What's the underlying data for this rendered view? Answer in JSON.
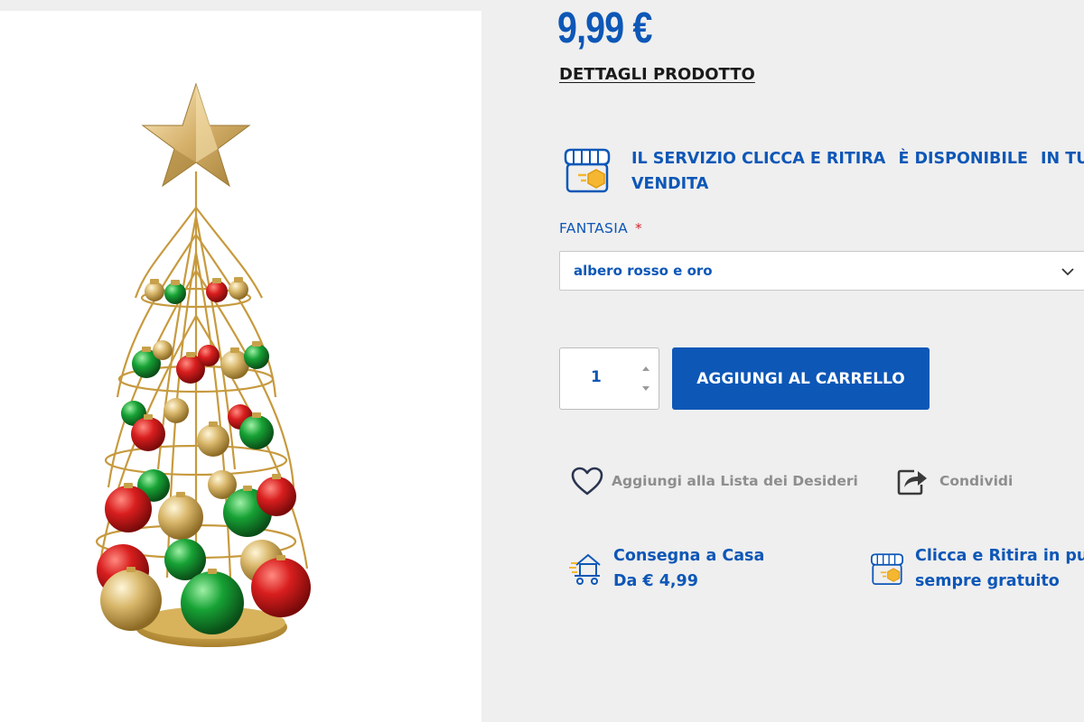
{
  "product": {
    "price": "9,99 €",
    "details_link": "DETTAGLI PRODOTTO",
    "image_icon": "christmas-tree-product-photo"
  },
  "service_banner": {
    "icon": "store-pickup-icon",
    "parts": [
      "IL SERVIZIO CLICCA E RITIRA",
      "È DISPONIBILE",
      "IN TUTTI"
    ],
    "line2": "VENDITA"
  },
  "variant": {
    "label": "FANTASIA",
    "required_mark": "*",
    "selected": "albero rosso e oro"
  },
  "purchase": {
    "quantity": "1",
    "add_to_cart": "AGGIUNGI AL CARRELLO"
  },
  "actions": {
    "wishlist": "Aggiungi alla Lista dei Desideri",
    "share": "Condividi"
  },
  "shipping": {
    "delivery_title": "Consegna a Casa",
    "delivery_price": "Da € 4,99",
    "pickup_title": "Clicca e Ritira in pu",
    "pickup_subtitle": "sempre gratuito"
  },
  "colors": {
    "brand_blue": "#0d57b7",
    "required_red": "#d3282f",
    "muted_gray": "#8e8e8e"
  }
}
